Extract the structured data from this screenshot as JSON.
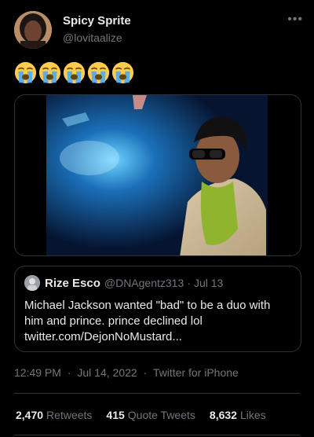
{
  "author": {
    "name": "Spicy Sprite",
    "handle": "@lovitaalize"
  },
  "tweet": {
    "emoji_icons": [
      "loudly-crying-face-icon",
      "loudly-crying-face-icon",
      "loudly-crying-face-icon",
      "loudly-crying-face-icon",
      "loudly-crying-face-icon"
    ]
  },
  "quote": {
    "name": "Rize Esco",
    "handle": "@DNAgentz313",
    "date": "Jul 13",
    "text": "Michael Jackson wanted \"bad\" to be a duo with him and prince. prince declined lol twitter.com/DejonNoMustard..."
  },
  "meta": {
    "time": "12:49 PM",
    "date": "Jul 14, 2022",
    "source": "Twitter for iPhone"
  },
  "stats": {
    "retweets_count": "2,470",
    "retweets_label": "Retweets",
    "quotes_count": "415",
    "quotes_label": "Quote Tweets",
    "likes_count": "8,632",
    "likes_label": "Likes"
  },
  "colors": {
    "background": "#000000",
    "text": "#e7e9ea",
    "secondary": "#71767b",
    "border": "#2f3336"
  }
}
